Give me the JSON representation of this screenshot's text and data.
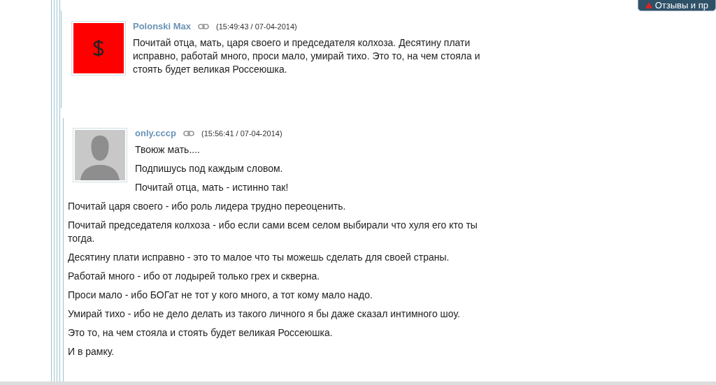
{
  "top_button": {
    "label": "Отзывы и пр"
  },
  "comments": [
    {
      "author": "Polonski Max",
      "kind": "dollar",
      "time": "(15:49:43 / 07-04-2014)",
      "paragraphs": [
        "Почитай отца, мать, царя своего и председателя колхоза. Десятину плати исправно, работай много, проси мало, умирай тихо. Это то, на чем стояла и стоять будет великая Россеюшка."
      ]
    },
    {
      "author": "only.cccp",
      "kind": "silhouette",
      "time": "(15:56:41 / 07-04-2014)",
      "paragraphs": [
        "Твоюж мать....",
        "Подпишусь под каждым словом.",
        "Почитай отца, мать - истинно так!",
        "Почитай царя своего - ибо роль лидера трудно переоценить.",
        "Почитай председателя колхоза - ибо если сами всем селом выбирали что хуля его кто ты тогда.",
        "Десятину плати исправно - это то малое что ты можешь сделать для своей страны.",
        "Работай много - ибо от лодырей только грех и скверна.",
        "Проси мало - ибо БОГат не тот у кого много, а тот кому мало надо.",
        "Умирай тихо - ибо не дело делать из такого личного я бы даже сказал интимного шоу.",
        "Это то, на чем стояла и стоять будет великая Россеюшка.",
        "И в рамку."
      ]
    }
  ]
}
